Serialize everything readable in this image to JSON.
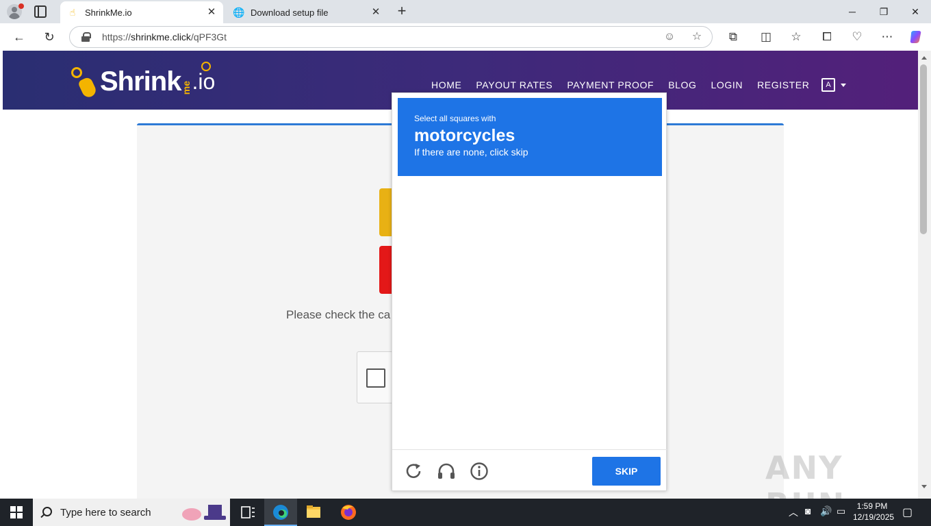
{
  "browser": {
    "tabs": [
      {
        "title": "ShrinkMe.io",
        "active": true,
        "icon": "hand-pointer-icon"
      },
      {
        "title": "Download setup file",
        "active": false,
        "icon": "globe-icon"
      }
    ],
    "url_prefix": "https://",
    "url_domain": "shrinkme.click",
    "url_path": "/qPF3Gt"
  },
  "site": {
    "logo_main": "Shrink",
    "logo_me": "me",
    "logo_io": ".io",
    "menu": [
      "HOME",
      "PAYOUT RATES",
      "PAYMENT PROOF",
      "BLOG",
      "LOGIN",
      "REGISTER"
    ],
    "check_text": "Please check the ca"
  },
  "captcha": {
    "line1": "Select all squares with",
    "target": "motorcycles",
    "line2": "If there are none, click skip",
    "skip_label": "SKIP",
    "grid": {
      "rows": 4,
      "cols": 4
    }
  },
  "watermark": "ANY RUN",
  "taskbar": {
    "search_placeholder": "Type here to search",
    "time": "1:59 PM",
    "date": "12/19/2025"
  }
}
